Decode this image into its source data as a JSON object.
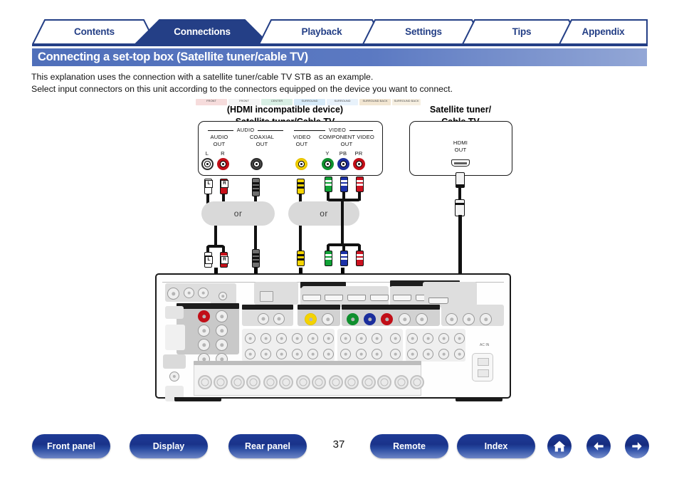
{
  "tabs": [
    {
      "label": "Contents",
      "active": false
    },
    {
      "label": "Connections",
      "active": true
    },
    {
      "label": "Playback",
      "active": false
    },
    {
      "label": "Settings",
      "active": false
    },
    {
      "label": "Tips",
      "active": false
    },
    {
      "label": "Appendix",
      "active": false
    }
  ],
  "page_title": "Connecting a set-top box (Satellite tuner/cable TV)",
  "intro": {
    "line1": "This explanation uses the connection with a satellite tuner/cable TV STB as an example.",
    "line2": "Select input connectors on this unit according to the connectors equipped on the device you want to connect."
  },
  "diagram": {
    "left_device": {
      "caption_line1": "(HDMI incompatible device)",
      "caption_line2": "Satellite tuner/Cable TV",
      "groups": [
        {
          "name": "AUDIO"
        },
        {
          "name": "VIDEO"
        }
      ],
      "ports": [
        {
          "label_line1": "AUDIO",
          "label_line2": "OUT",
          "sublabels": [
            "L",
            "R"
          ],
          "colors": [
            "white",
            "red"
          ]
        },
        {
          "label_line1": "COAXIAL",
          "label_line2": "OUT",
          "sublabels": [],
          "colors": [
            "black"
          ]
        },
        {
          "label_line1": "VIDEO",
          "label_line2": "OUT",
          "sublabels": [],
          "colors": [
            "yellow"
          ]
        },
        {
          "label_line1": "COMPONENT VIDEO",
          "label_line2": "OUT",
          "sublabels": [
            "Y",
            "PB",
            "PR"
          ],
          "colors": [
            "green",
            "blue",
            "red"
          ]
        }
      ]
    },
    "right_device": {
      "caption_line1": "Satellite tuner/",
      "caption_line2": "Cable TV",
      "port_label_line1": "HDMI",
      "port_label_line2": "OUT"
    },
    "or_labels": [
      "or",
      "or"
    ],
    "cable_tags": [
      "L",
      "R",
      "L",
      "R"
    ]
  },
  "receiver": {
    "speaker_groups": [
      {
        "label": "FRONT",
        "color": "#f6dcdc"
      },
      {
        "label": "FRONT",
        "color": "#f2f2f2"
      },
      {
        "label": "CENTER",
        "color": "#d8efe4"
      },
      {
        "label": "SURROUND",
        "color": "#d6eaf8"
      },
      {
        "label": "SURROUND",
        "color": "#e8f2fb"
      },
      {
        "label": "SURROUND BACK",
        "color": "#f2e6d2"
      },
      {
        "label": "SURROUND BACK",
        "color": "#f6efe1"
      }
    ],
    "ac_label": "AC IN"
  },
  "bottom_nav": {
    "buttons": [
      {
        "label": "Front panel"
      },
      {
        "label": "Display"
      },
      {
        "label": "Rear panel"
      },
      {
        "label": "Remote"
      },
      {
        "label": "Index"
      }
    ],
    "page_number": "37",
    "icons": [
      "home-icon",
      "arrow-left-icon",
      "arrow-right-icon"
    ]
  },
  "colors": {
    "brand_blue": "#1e3b96",
    "tab_navy": "#243f86",
    "title_bar": "#5b79c2"
  }
}
